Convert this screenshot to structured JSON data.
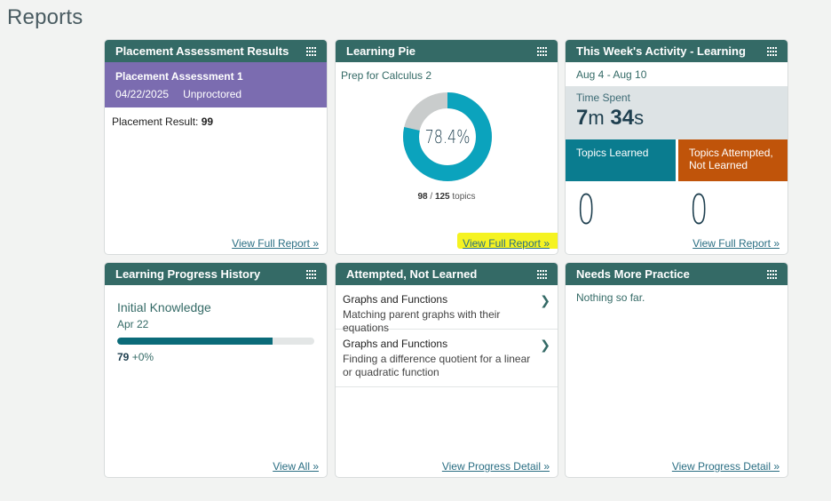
{
  "page": {
    "title": "Reports"
  },
  "icons": {
    "menu_icon": "grid-dots-icon",
    "chevron": "chevron-right-icon"
  },
  "colors": {
    "header": "#346a66",
    "purple": "#7b6cb0",
    "teal": "#0a7c8f",
    "orange": "#c0540a",
    "ring": "#0ba3bd",
    "ring_bg": "#c9cccc",
    "highlight": "#f5f321"
  },
  "placement": {
    "title": "Placement Assessment Results",
    "assessment_name": "Placement Assessment 1",
    "date": "04/22/2025",
    "mode": "Unproctored",
    "result_label": "Placement Result:",
    "result_value": "99",
    "link": "View Full Report »"
  },
  "pie": {
    "title": "Learning Pie",
    "course": "Prep for Calculus 2",
    "percent_label": "78.4%",
    "learned": "98",
    "total": "125",
    "topics_label": "topics",
    "fraction": 0.784,
    "link": "View Full Report »"
  },
  "activity": {
    "title": "This Week's Activity - Learning",
    "range": "Aug 4 - Aug 10",
    "time_label": "Time Spent",
    "minutes": "7",
    "minutes_unit": "m",
    "seconds": "34",
    "seconds_unit": "s",
    "learned_label": "Topics Learned",
    "learned_count": "0",
    "attempted_label": "Topics Attempted, Not Learned",
    "attempted_count": "0",
    "link": "View Full Report »"
  },
  "history": {
    "title": "Learning Progress History",
    "entry_title": "Initial Knowledge",
    "entry_date": "Apr 22",
    "score": "79",
    "delta": "+0%",
    "progress_fraction": 0.79,
    "link": "View All »"
  },
  "attempted": {
    "title": "Attempted, Not Learned",
    "items": [
      {
        "category": "Graphs and Functions",
        "topic": "Matching parent graphs with their equations"
      },
      {
        "category": "Graphs and Functions",
        "topic": "Finding a difference quotient for a linear or quadratic function"
      }
    ],
    "link": "View Progress Detail »"
  },
  "practice": {
    "title": "Needs More Practice",
    "empty": "Nothing so far.",
    "link": "View Progress Detail »"
  }
}
